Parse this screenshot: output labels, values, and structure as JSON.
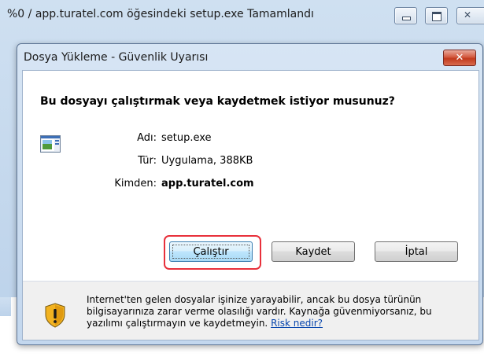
{
  "background_window": {
    "title": "%0 / app.turatel.com öğesindeki setup.exe Tamamlandı"
  },
  "dialog": {
    "title": "Dosya Yükleme - Güvenlik Uyarısı",
    "close_glyph": "✕",
    "question": "Bu dosyayı çalıştırmak veya kaydetmek istiyor musunuz?",
    "file": {
      "name_label": "Adı:",
      "name_value": "setup.exe",
      "type_label": "Tür:",
      "type_value": "Uygulama, 388KB",
      "from_label": "Kimden:",
      "from_value": "app.turatel.com",
      "icon": "application-icon"
    },
    "buttons": {
      "run": "Çalıştır",
      "save": "Kaydet",
      "cancel": "İptal"
    },
    "warning": {
      "icon": "shield-warning-icon",
      "text": "Internet'ten gelen dosyalar işinize yarayabilir, ancak bu dosya türünün bilgisayarınıza zarar verme olasılığı vardır. Kaynağa güvenmiyorsanız, bu yazılımı çalıştırmayın ve kaydetmeyin. ",
      "link": "Risk nedir?"
    }
  },
  "colors": {
    "highlight": "#e8303b",
    "titlebar": "#c9dcf0",
    "link": "#0645ad"
  }
}
